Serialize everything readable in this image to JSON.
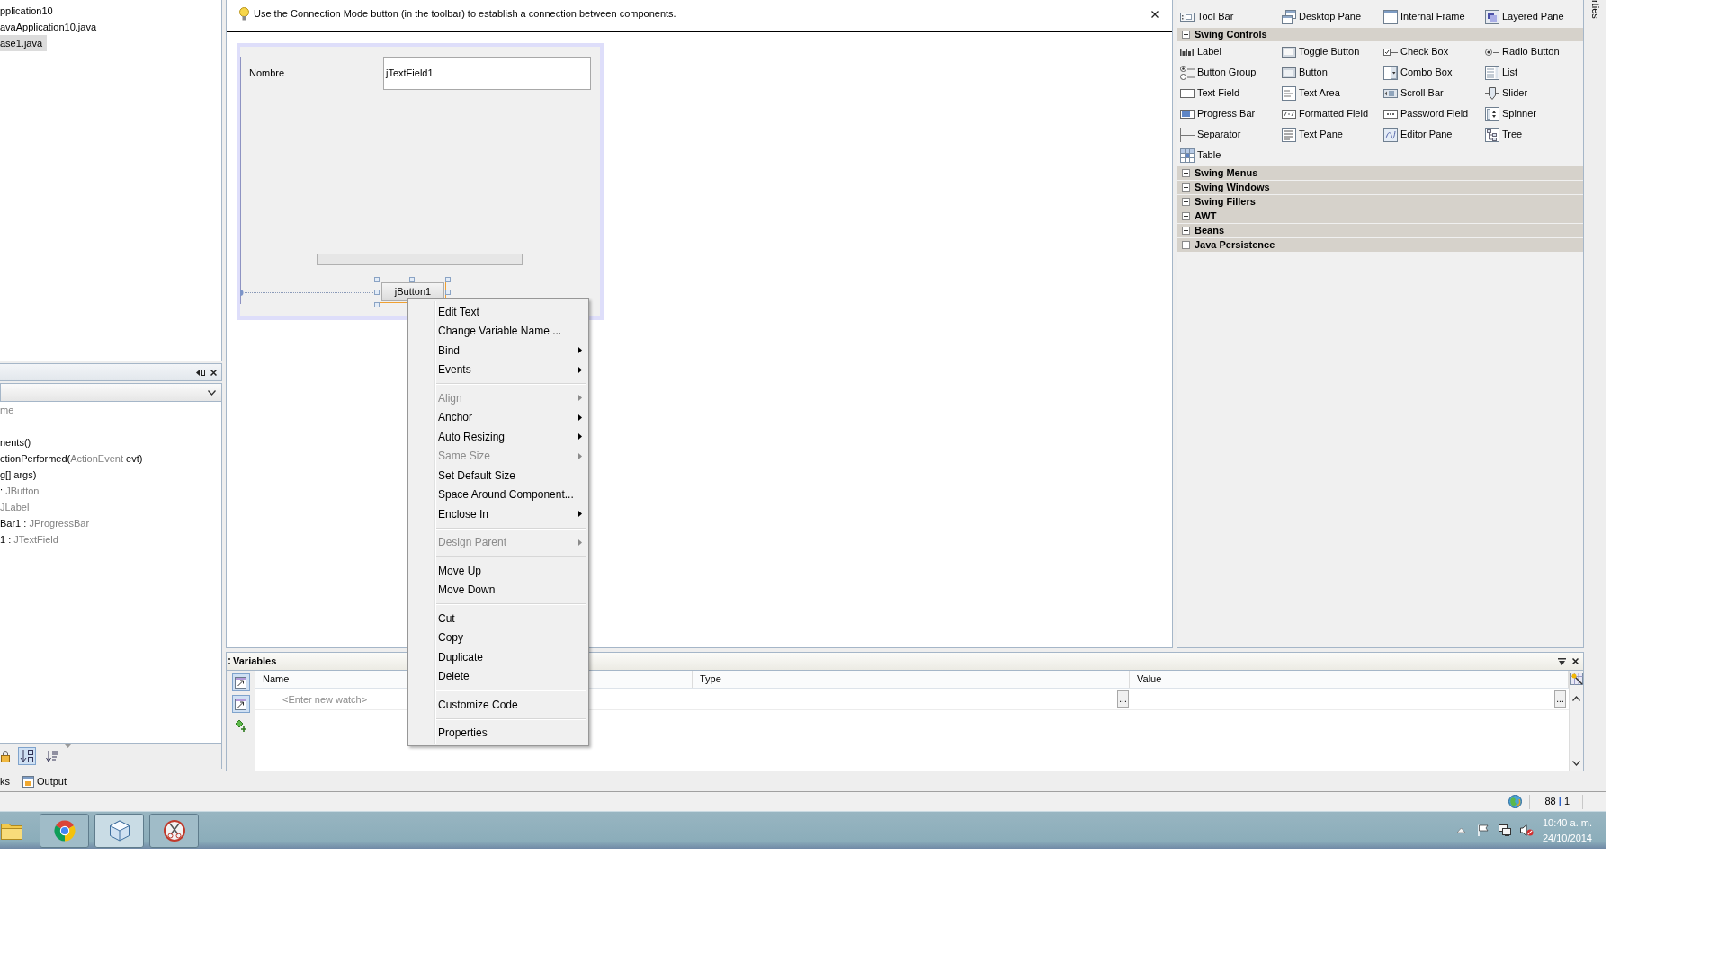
{
  "project_tree": {
    "items": [
      {
        "label": "pplication10",
        "selected": false
      },
      {
        "label": "avaApplication10.java",
        "selected": false
      },
      {
        "label": "ase1.java",
        "selected": true
      }
    ]
  },
  "navigator": {
    "items": [
      {
        "segments": [
          {
            "text": "me",
            "muted": true
          }
        ]
      },
      {
        "segments": [
          {
            "text": "nents()",
            "muted": false
          }
        ]
      },
      {
        "segments": [
          {
            "text": "ctionPerformed(",
            "muted": false
          },
          {
            "text": "ActionEvent",
            "muted": true
          },
          {
            "text": " evt)",
            "muted": false
          }
        ]
      },
      {
        "segments": [
          {
            "text": "g[] args)",
            "muted": false
          }
        ]
      },
      {
        "segments": [
          {
            "text": ": ",
            "muted": false
          },
          {
            "text": "JButton",
            "muted": true
          }
        ]
      },
      {
        "segments": [
          {
            "text": "JLabel",
            "muted": true
          }
        ]
      },
      {
        "segments": [
          {
            "text": "Bar1 : ",
            "muted": false
          },
          {
            "text": "JProgressBar",
            "muted": true
          }
        ]
      },
      {
        "segments": [
          {
            "text": "1 : ",
            "muted": false
          },
          {
            "text": "JTextField",
            "muted": true
          }
        ]
      }
    ],
    "toolbar": [
      {
        "selected": false
      },
      {
        "selected": true
      },
      {
        "selected": false
      }
    ]
  },
  "designer": {
    "hint": "Use the Connection Mode button (in the toolbar) to establish a connection between components.",
    "form": {
      "label": "Nombre",
      "text_field": {
        "value": "jTextField1"
      },
      "progress_bar": {
        "level": 0
      },
      "button": {
        "label": "jButton1",
        "selected": true
      }
    }
  },
  "context_menu": {
    "groups": [
      {
        "items": [
          {
            "label": "Edit Text",
            "disabled": false,
            "submenu": false
          },
          {
            "label": "Change Variable Name ...",
            "disabled": false,
            "submenu": false
          },
          {
            "label": "Bind",
            "disabled": false,
            "submenu": true
          },
          {
            "label": "Events",
            "disabled": false,
            "submenu": true
          }
        ]
      },
      {
        "items": [
          {
            "label": "Align",
            "disabled": true,
            "submenu": true
          },
          {
            "label": "Anchor",
            "disabled": false,
            "submenu": true
          },
          {
            "label": "Auto Resizing",
            "disabled": false,
            "submenu": true
          },
          {
            "label": "Same Size",
            "disabled": true,
            "submenu": true
          },
          {
            "label": "Set Default Size",
            "disabled": false,
            "submenu": false
          },
          {
            "label": "Space Around Component...",
            "disabled": false,
            "submenu": false
          },
          {
            "label": "Enclose In",
            "disabled": false,
            "submenu": true
          }
        ]
      },
      {
        "items": [
          {
            "label": "Design Parent",
            "disabled": true,
            "submenu": true
          }
        ]
      },
      {
        "items": [
          {
            "label": "Move Up",
            "disabled": false,
            "submenu": false
          },
          {
            "label": "Move Down",
            "disabled": false,
            "submenu": false
          }
        ]
      },
      {
        "items": [
          {
            "label": "Cut",
            "disabled": false,
            "submenu": false
          },
          {
            "label": "Copy",
            "disabled": false,
            "submenu": false
          },
          {
            "label": "Duplicate",
            "disabled": false,
            "submenu": false
          },
          {
            "label": "Delete",
            "disabled": false,
            "submenu": false
          }
        ]
      },
      {
        "items": [
          {
            "label": "Customize Code",
            "disabled": false,
            "submenu": false
          }
        ]
      },
      {
        "items": [
          {
            "label": "Properties",
            "disabled": false,
            "submenu": false
          }
        ]
      }
    ]
  },
  "palette": {
    "above_items": [
      "Tool Bar",
      "Desktop Pane",
      "Internal Frame",
      "Layered Pane"
    ],
    "categories": [
      {
        "label": "Swing Controls",
        "expanded": true,
        "items": [
          "Label",
          "Toggle Button",
          "Check Box",
          "Radio Button",
          "Button Group",
          "Button",
          "Combo Box",
          "List",
          "Text Field",
          "Text Area",
          "Scroll Bar",
          "Slider",
          "Progress Bar",
          "Formatted Field",
          "Password Field",
          "Spinner",
          "Separator",
          "Text Pane",
          "Editor Pane",
          "Tree",
          "Table"
        ]
      },
      {
        "label": "Swing Menus",
        "expanded": false
      },
      {
        "label": "Swing Windows",
        "expanded": false
      },
      {
        "label": "Swing Fillers",
        "expanded": false
      },
      {
        "label": "AWT",
        "expanded": false
      },
      {
        "label": "Beans",
        "expanded": false
      },
      {
        "label": "Java Persistence",
        "expanded": false
      }
    ]
  },
  "properties_tab": {
    "label": "rties"
  },
  "variables": {
    "title": "Variables",
    "toolbar": [
      {
        "selected": true
      },
      {
        "selected": true
      },
      {
        "selected": false
      }
    ],
    "columns": [
      "Name",
      "Type",
      "Value"
    ],
    "new_watch": {
      "placeholder": "<Enter new watch>",
      "type_button": "...",
      "value_button": "..."
    }
  },
  "bottom_tabs": [
    {
      "label": "ks",
      "kind": "clipped"
    },
    {
      "label": "Output",
      "kind": "output"
    }
  ],
  "status_bar": {
    "position": {
      "line": "88",
      "separator": "|",
      "column": "1"
    }
  },
  "taskbar": {
    "apps": [
      {
        "running": false,
        "selected": false
      },
      {
        "running": true,
        "selected": false
      },
      {
        "running": true,
        "selected": true
      },
      {
        "running": true,
        "selected": false
      }
    ],
    "clock": {
      "time": "10:40 a. m.",
      "date": "24/10/2014"
    }
  }
}
